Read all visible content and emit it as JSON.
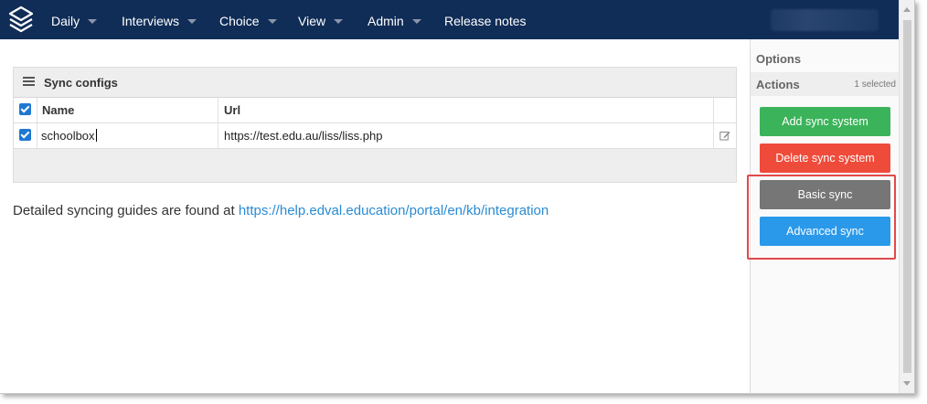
{
  "navbar": {
    "logo_icon": "layers-logo-icon",
    "items": [
      {
        "label": "Daily",
        "has_caret": true
      },
      {
        "label": "Interviews",
        "has_caret": true
      },
      {
        "label": "Choice",
        "has_caret": true
      },
      {
        "label": "View",
        "has_caret": true
      },
      {
        "label": "Admin",
        "has_caret": true
      },
      {
        "label": "Release notes",
        "has_caret": false
      }
    ],
    "background": "#102d57"
  },
  "panel": {
    "title": "Sync configs",
    "icon": "list-icon",
    "columns": [
      "Name",
      "Url"
    ],
    "header_checked": true,
    "rows": [
      {
        "checked": true,
        "name": "schoolbox",
        "url": "https://test.edu.au/liss/liss.php",
        "action_icon": "edit-icon"
      }
    ]
  },
  "guide": {
    "text": "Detailed syncing guides are found at ",
    "link": "https://help.edval.education/portal/en/kb/integration"
  },
  "sidebar": {
    "options_label": "Options",
    "actions_label": "Actions",
    "selected_count": "1 selected",
    "buttons": [
      {
        "label": "Add sync system",
        "color": "#3bb35a"
      },
      {
        "label": "Delete sync system",
        "color": "#ef4b3a"
      },
      {
        "label": "Basic sync",
        "color": "#767676"
      },
      {
        "label": "Advanced sync",
        "color": "#2b99ea"
      }
    ],
    "highlight_color": "#e0494a"
  }
}
